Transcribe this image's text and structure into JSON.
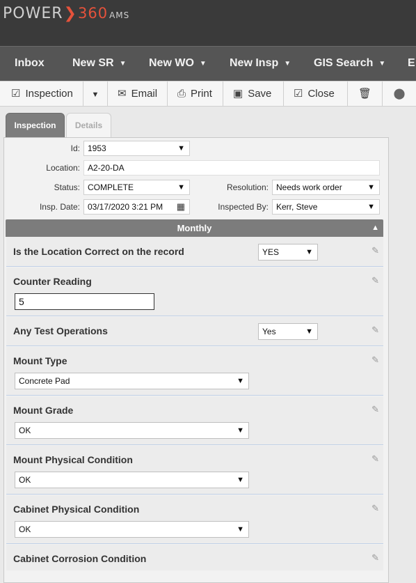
{
  "app": {
    "logo_part1": "POWER",
    "logo_part2": "360",
    "logo_part3": "AMS"
  },
  "nav": {
    "inbox": "Inbox",
    "new_sr": "New SR",
    "new_wo": "New WO",
    "new_insp": "New Insp",
    "gis_search": "GIS Search",
    "more": "E"
  },
  "toolbar": {
    "inspection": "Inspection",
    "email": "Email",
    "print": "Print",
    "save": "Save",
    "close": "Close"
  },
  "tabs": {
    "inspection": "Inspection",
    "details": "Details"
  },
  "form": {
    "id_label": "Id:",
    "id_value": "1953",
    "location_label": "Location:",
    "location_value": "A2-20-DA",
    "status_label": "Status:",
    "status_value": "COMPLETE",
    "resolution_label": "Resolution:",
    "resolution_value": "Needs work order",
    "insp_date_label": "Insp. Date:",
    "insp_date_value": "03/17/2020 3:21 PM",
    "inspected_by_label": "Inspected By:",
    "inspected_by_value": "Kerr, Steve"
  },
  "section": {
    "title": "Monthly"
  },
  "questions": [
    {
      "title": "Is the Location Correct on the record",
      "value": "YES"
    },
    {
      "title": "Counter Reading",
      "value": "5"
    },
    {
      "title": "Any Test Operations",
      "value": "Yes"
    },
    {
      "title": "Mount Type",
      "value": "Concrete Pad"
    },
    {
      "title": "Mount Grade",
      "value": "OK"
    },
    {
      "title": "Mount Physical Condition",
      "value": "OK"
    },
    {
      "title": "Cabinet Physical Condition",
      "value": "OK"
    },
    {
      "title": "Cabinet Corrosion Condition",
      "value": ""
    }
  ],
  "icons": {
    "checkbox": "check-square-icon",
    "email": "envelope-icon",
    "print": "printer-icon",
    "save": "floppy-icon",
    "close": "check-square-icon",
    "delete": "trash-icon",
    "map": "map-pin-icon",
    "calendar": "calendar-icon",
    "edit": "pencil-icon"
  },
  "colors": {
    "topbar": "#3a3a3a",
    "navbar": "#555555",
    "brand_accent": "#e5523b",
    "section_head": "#7c7c7c"
  }
}
